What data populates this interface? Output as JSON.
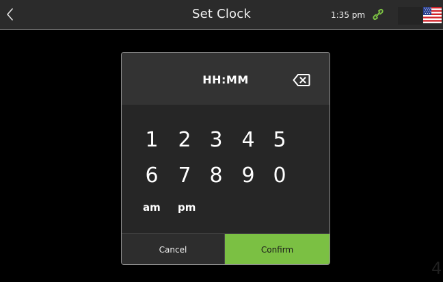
{
  "header": {
    "title": "Set Clock",
    "time": "1:35 pm",
    "back_icon": "chevron-left-icon",
    "link_icon": "link-icon",
    "flag_icon": "us-flag-icon",
    "accent_color": "#7bc043"
  },
  "dialog": {
    "display": "HH:MM",
    "backspace_icon": "backspace-icon",
    "keys_row1": [
      "1",
      "2",
      "3",
      "4",
      "5"
    ],
    "keys_row2": [
      "6",
      "7",
      "8",
      "9",
      "0"
    ],
    "am_label": "am",
    "pm_label": "pm",
    "cancel_label": "Cancel",
    "confirm_label": "Confirm",
    "confirm_color": "#7bc043"
  },
  "background": {
    "corner_digit": "4"
  }
}
